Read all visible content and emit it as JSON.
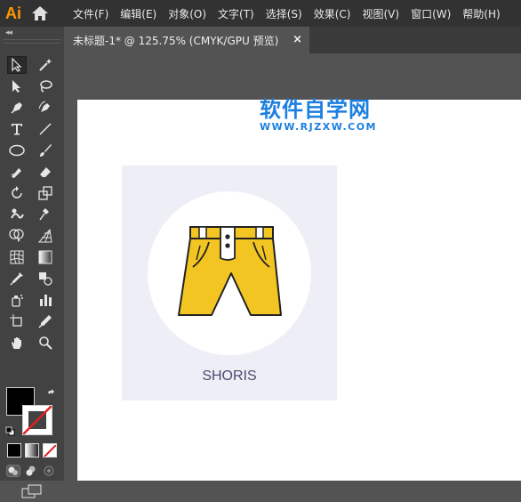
{
  "app": {
    "logo": "Ai"
  },
  "menu": [
    "文件(F)",
    "编辑(E)",
    "对象(O)",
    "文字(T)",
    "选择(S)",
    "效果(C)",
    "视图(V)",
    "窗口(W)",
    "帮助(H)"
  ],
  "tab": {
    "title": "未标题-1* @ 125.75% (CMYK/GPU 预览)",
    "close": "×"
  },
  "toolbar": {
    "collapse": "◂◂"
  },
  "watermark": {
    "title": "软件自学网",
    "url": "WWW.RJZXW.COM"
  },
  "artwork": {
    "label": "SHORIS",
    "card_color": "#eeeef7",
    "shorts_color": "#f2c523",
    "label_color": "#4a4c70"
  },
  "colors": {
    "fill": "#000000",
    "stroke": "none",
    "accent": "#ff9a00"
  }
}
